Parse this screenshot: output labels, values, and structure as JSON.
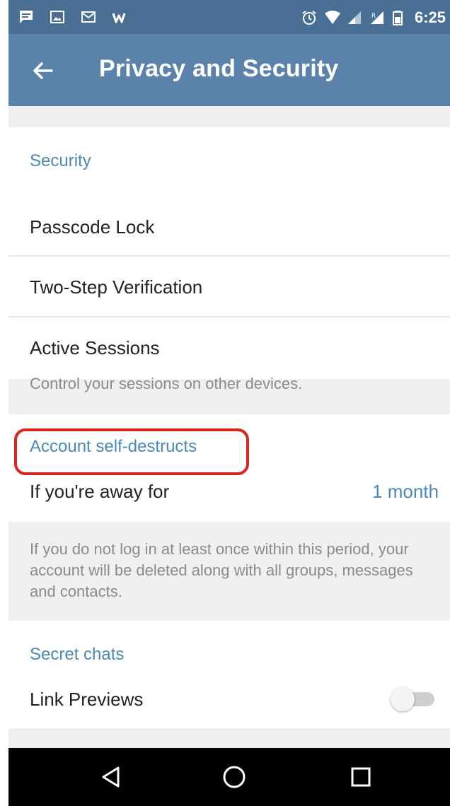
{
  "status_bar": {
    "time": "6:25",
    "icons_left": [
      "message-icon",
      "image-icon",
      "mail-icon",
      "w-app-icon"
    ],
    "icons_right": [
      "alarm-icon",
      "wifi-icon",
      "signal-icon",
      "roaming-signal-icon",
      "battery-icon"
    ]
  },
  "app_bar": {
    "title": "Privacy and Security",
    "back_icon": "arrow-back-icon",
    "background": "#5b82aa"
  },
  "security": {
    "section_title": "Security",
    "items": [
      {
        "label": "Passcode Lock"
      },
      {
        "label": "Two-Step Verification"
      },
      {
        "label": "Active Sessions"
      }
    ],
    "note": "Control your sessions on other devices."
  },
  "self_destruct": {
    "section_title": "Account self-destructs",
    "row_label": "If you're away for",
    "row_value": "1 month",
    "note": "If you do not log in at least once within this period, your account will be deleted along with all groups, messages and contacts.",
    "highlight_color": "#d8261f"
  },
  "secret_chats": {
    "section_title": "Secret chats",
    "link_previews_label": "Link Previews",
    "link_previews_enabled": false
  },
  "nav_bar": {
    "buttons": [
      "back-triangle-icon",
      "home-circle-icon",
      "recents-square-icon"
    ]
  },
  "colors": {
    "accent": "#4a89b8",
    "status_bar": "#4a6f95",
    "note_text": "#8b8b8b"
  }
}
